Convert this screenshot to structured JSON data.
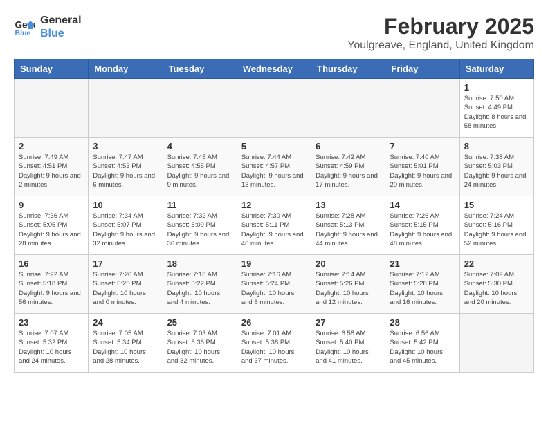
{
  "header": {
    "logo_line1": "General",
    "logo_line2": "Blue",
    "month": "February 2025",
    "location": "Youlgreave, England, United Kingdom"
  },
  "weekdays": [
    "Sunday",
    "Monday",
    "Tuesday",
    "Wednesday",
    "Thursday",
    "Friday",
    "Saturday"
  ],
  "weeks": [
    {
      "days": [
        {
          "num": "",
          "info": ""
        },
        {
          "num": "",
          "info": ""
        },
        {
          "num": "",
          "info": ""
        },
        {
          "num": "",
          "info": ""
        },
        {
          "num": "",
          "info": ""
        },
        {
          "num": "",
          "info": ""
        },
        {
          "num": "1",
          "info": "Sunrise: 7:50 AM\nSunset: 4:49 PM\nDaylight: 8 hours and 58 minutes."
        }
      ]
    },
    {
      "days": [
        {
          "num": "2",
          "info": "Sunrise: 7:49 AM\nSunset: 4:51 PM\nDaylight: 9 hours and 2 minutes."
        },
        {
          "num": "3",
          "info": "Sunrise: 7:47 AM\nSunset: 4:53 PM\nDaylight: 9 hours and 6 minutes."
        },
        {
          "num": "4",
          "info": "Sunrise: 7:45 AM\nSunset: 4:55 PM\nDaylight: 9 hours and 9 minutes."
        },
        {
          "num": "5",
          "info": "Sunrise: 7:44 AM\nSunset: 4:57 PM\nDaylight: 9 hours and 13 minutes."
        },
        {
          "num": "6",
          "info": "Sunrise: 7:42 AM\nSunset: 4:59 PM\nDaylight: 9 hours and 17 minutes."
        },
        {
          "num": "7",
          "info": "Sunrise: 7:40 AM\nSunset: 5:01 PM\nDaylight: 9 hours and 20 minutes."
        },
        {
          "num": "8",
          "info": "Sunrise: 7:38 AM\nSunset: 5:03 PM\nDaylight: 9 hours and 24 minutes."
        }
      ]
    },
    {
      "days": [
        {
          "num": "9",
          "info": "Sunrise: 7:36 AM\nSunset: 5:05 PM\nDaylight: 9 hours and 28 minutes."
        },
        {
          "num": "10",
          "info": "Sunrise: 7:34 AM\nSunset: 5:07 PM\nDaylight: 9 hours and 32 minutes."
        },
        {
          "num": "11",
          "info": "Sunrise: 7:32 AM\nSunset: 5:09 PM\nDaylight: 9 hours and 36 minutes."
        },
        {
          "num": "12",
          "info": "Sunrise: 7:30 AM\nSunset: 5:11 PM\nDaylight: 9 hours and 40 minutes."
        },
        {
          "num": "13",
          "info": "Sunrise: 7:28 AM\nSunset: 5:13 PM\nDaylight: 9 hours and 44 minutes."
        },
        {
          "num": "14",
          "info": "Sunrise: 7:26 AM\nSunset: 5:15 PM\nDaylight: 9 hours and 48 minutes."
        },
        {
          "num": "15",
          "info": "Sunrise: 7:24 AM\nSunset: 5:16 PM\nDaylight: 9 hours and 52 minutes."
        }
      ]
    },
    {
      "days": [
        {
          "num": "16",
          "info": "Sunrise: 7:22 AM\nSunset: 5:18 PM\nDaylight: 9 hours and 56 minutes."
        },
        {
          "num": "17",
          "info": "Sunrise: 7:20 AM\nSunset: 5:20 PM\nDaylight: 10 hours and 0 minutes."
        },
        {
          "num": "18",
          "info": "Sunrise: 7:18 AM\nSunset: 5:22 PM\nDaylight: 10 hours and 4 minutes."
        },
        {
          "num": "19",
          "info": "Sunrise: 7:16 AM\nSunset: 5:24 PM\nDaylight: 10 hours and 8 minutes."
        },
        {
          "num": "20",
          "info": "Sunrise: 7:14 AM\nSunset: 5:26 PM\nDaylight: 10 hours and 12 minutes."
        },
        {
          "num": "21",
          "info": "Sunrise: 7:12 AM\nSunset: 5:28 PM\nDaylight: 10 hours and 16 minutes."
        },
        {
          "num": "22",
          "info": "Sunrise: 7:09 AM\nSunset: 5:30 PM\nDaylight: 10 hours and 20 minutes."
        }
      ]
    },
    {
      "days": [
        {
          "num": "23",
          "info": "Sunrise: 7:07 AM\nSunset: 5:32 PM\nDaylight: 10 hours and 24 minutes."
        },
        {
          "num": "24",
          "info": "Sunrise: 7:05 AM\nSunset: 5:34 PM\nDaylight: 10 hours and 28 minutes."
        },
        {
          "num": "25",
          "info": "Sunrise: 7:03 AM\nSunset: 5:36 PM\nDaylight: 10 hours and 32 minutes."
        },
        {
          "num": "26",
          "info": "Sunrise: 7:01 AM\nSunset: 5:38 PM\nDaylight: 10 hours and 37 minutes."
        },
        {
          "num": "27",
          "info": "Sunrise: 6:58 AM\nSunset: 5:40 PM\nDaylight: 10 hours and 41 minutes."
        },
        {
          "num": "28",
          "info": "Sunrise: 6:56 AM\nSunset: 5:42 PM\nDaylight: 10 hours and 45 minutes."
        },
        {
          "num": "",
          "info": ""
        }
      ]
    }
  ]
}
